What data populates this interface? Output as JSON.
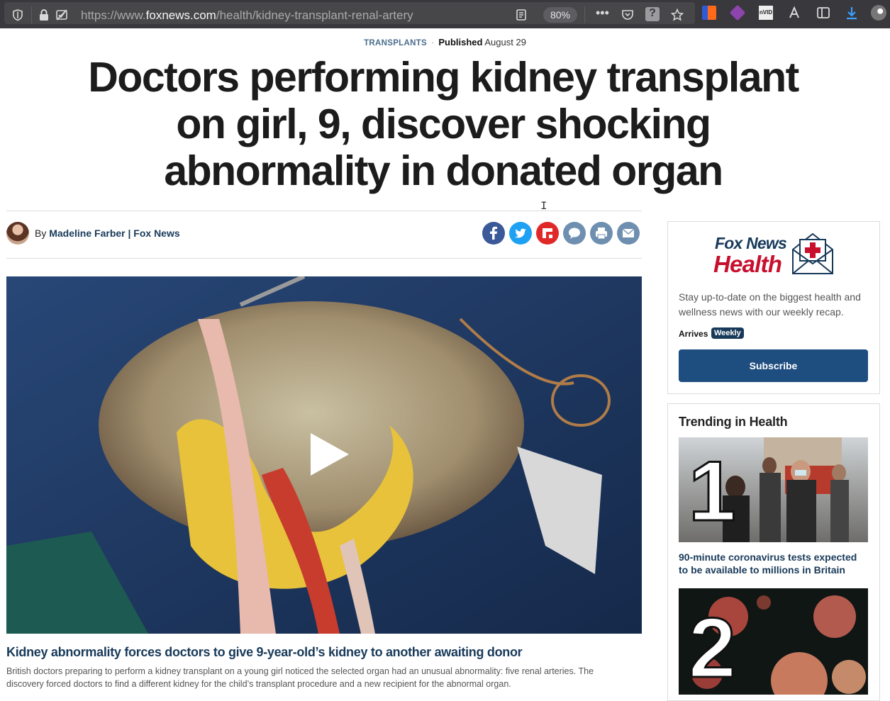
{
  "browser": {
    "url_prefix": "https://www.",
    "url_domain": "foxnews.com",
    "url_path": "/health/kidney-transplant-renal-artery",
    "zoom": "80%"
  },
  "article": {
    "category": "TRANSPLANTS",
    "published_label": "Published",
    "published_date": "August 29",
    "headline": "Doctors performing kidney transplant on girl, 9, discover shocking abnormality in donated organ",
    "byline_prefix": "By",
    "author": "Madeline Farber | Fox News",
    "video_caption_title": "Kidney abnormality forces doctors to give 9-year-old’s kidney to another awaiting donor",
    "video_caption_text": "British doctors preparing to perform a kidney transplant on a young girl noticed the selected organ had an unusual abnormality: five renal arteries. The discovery forced doctors to find a different kidney for the child’s transplant procedure and a new recipient for the abnormal organ."
  },
  "share": {
    "facebook": "f",
    "twitter": "t",
    "flipboard": "F",
    "comments": "c",
    "print": "p",
    "email": "e"
  },
  "newsletter": {
    "brand_top": "Fox News",
    "brand_bottom": "Health",
    "description": "Stay up-to-date on the biggest health and wellness news with our weekly recap.",
    "arrives_label": "Arrives",
    "frequency": "Weekly",
    "subscribe_label": "Subscribe"
  },
  "trending": {
    "title": "Trending in Health",
    "items": [
      {
        "rank": "1",
        "headline": "90-minute coronavirus tests expected to be available to millions in Britain"
      },
      {
        "rank": "2",
        "headline": ""
      }
    ]
  }
}
